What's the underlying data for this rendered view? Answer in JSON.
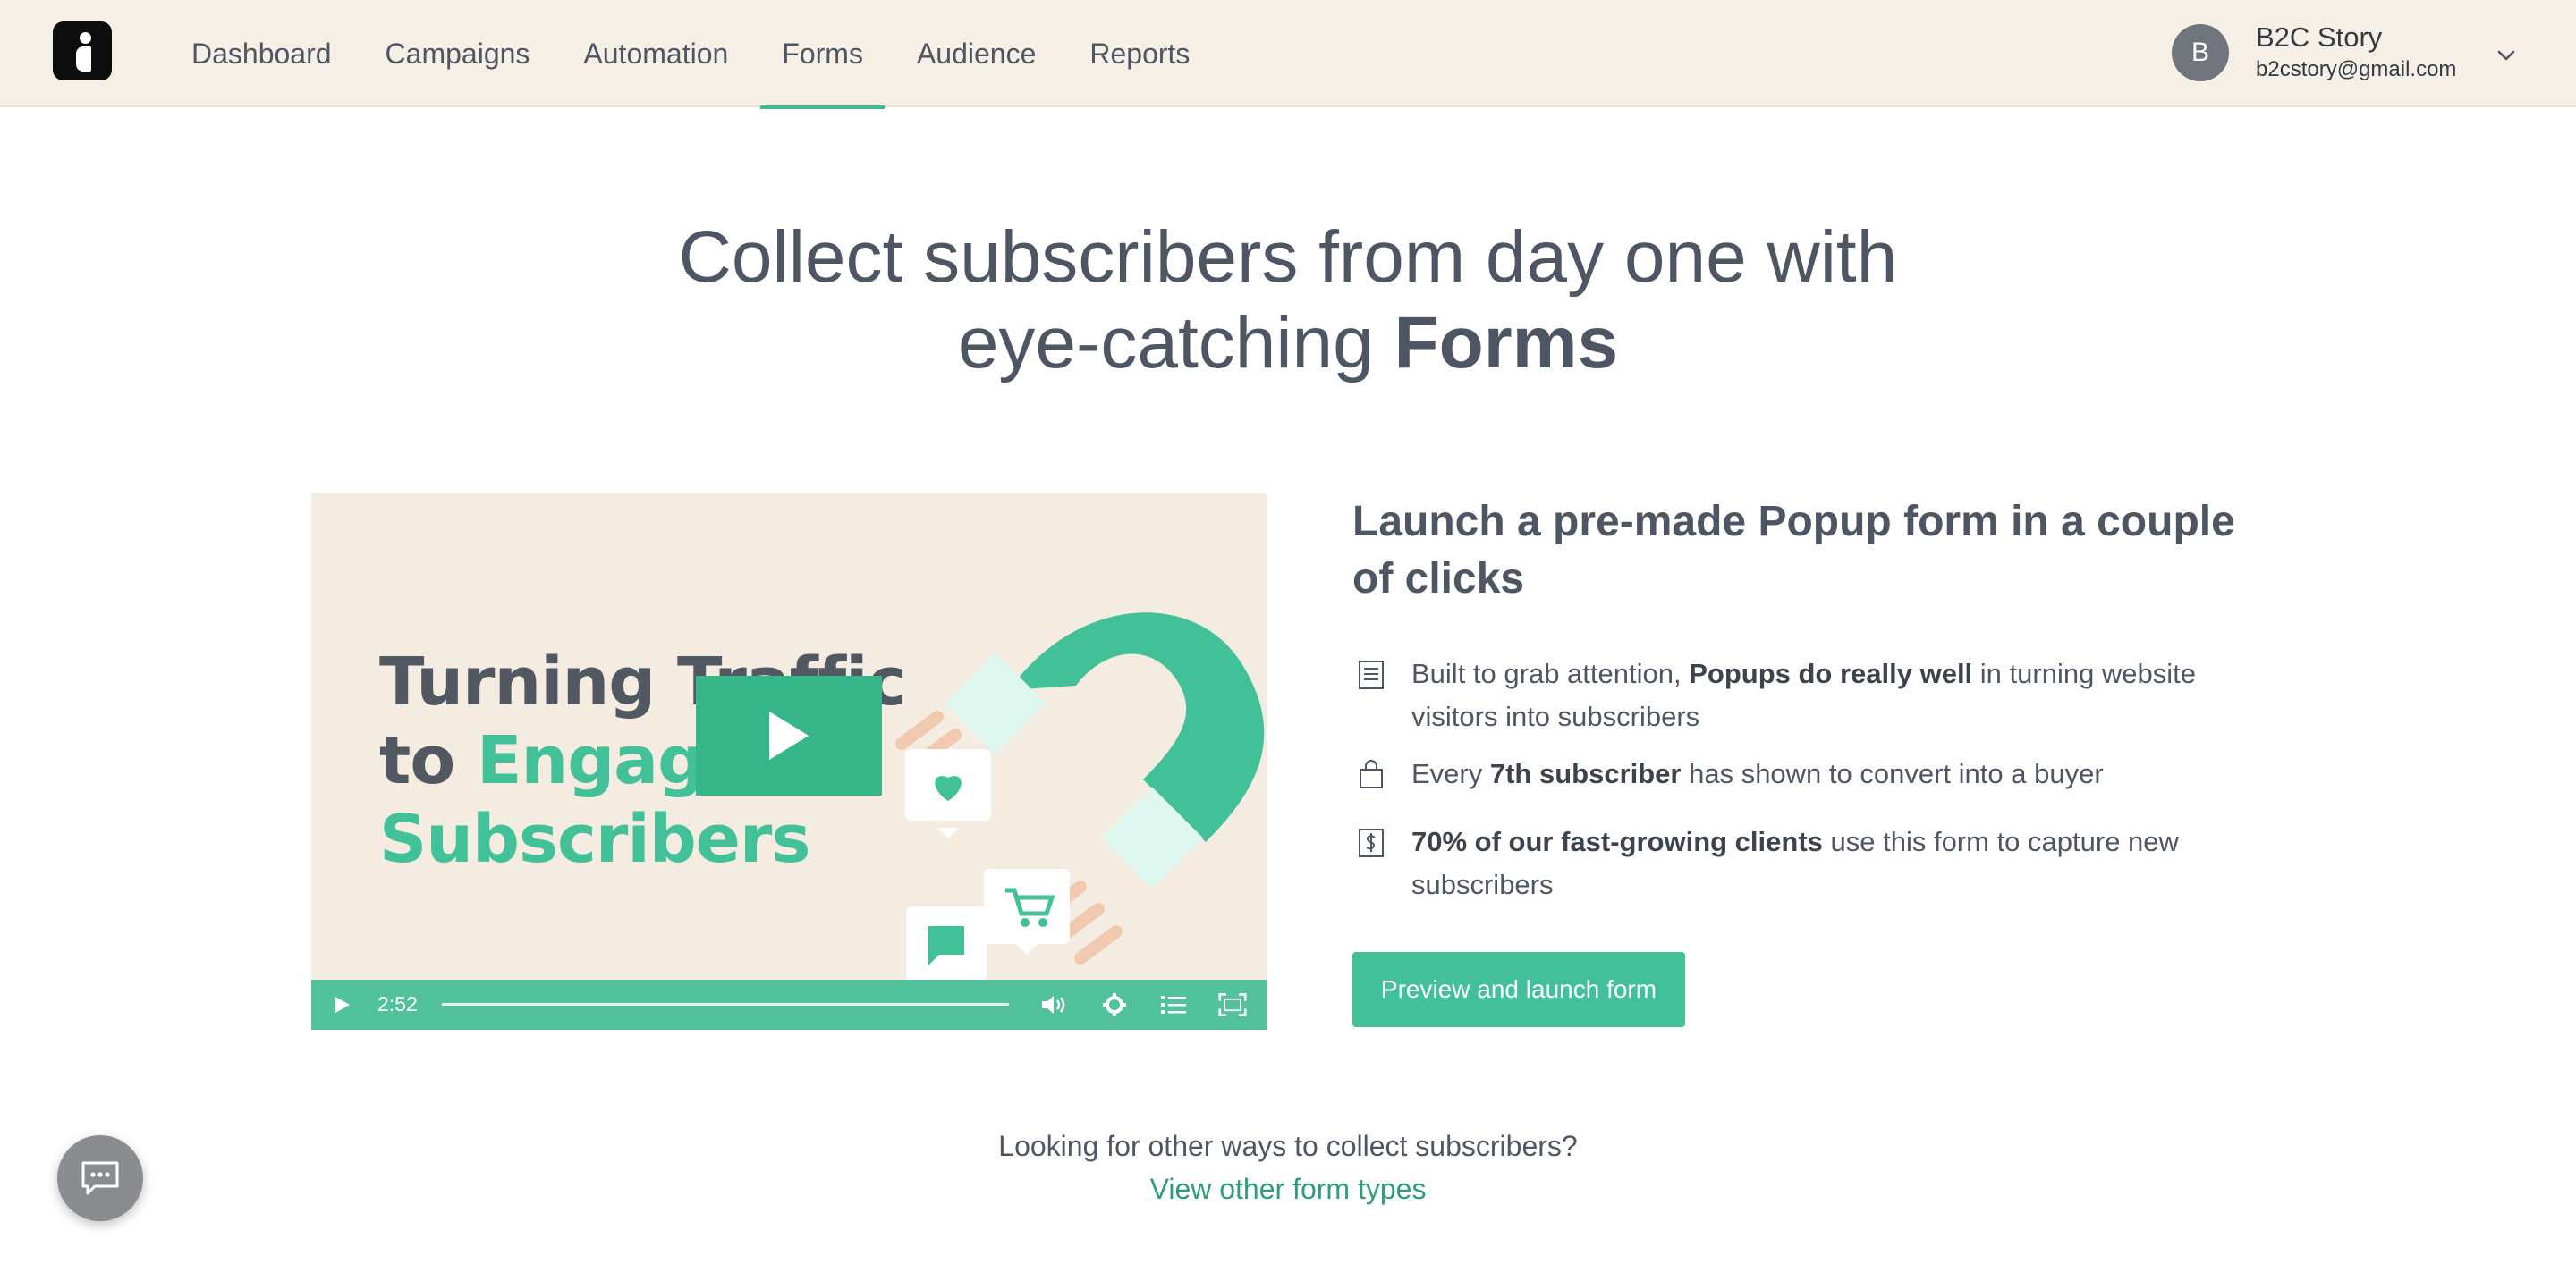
{
  "nav": {
    "items": [
      {
        "label": "Dashboard"
      },
      {
        "label": "Campaigns"
      },
      {
        "label": "Automation"
      },
      {
        "label": "Forms",
        "active": true
      },
      {
        "label": "Audience"
      },
      {
        "label": "Reports"
      }
    ]
  },
  "account": {
    "avatar_initial": "B",
    "name": "B2C Story",
    "email": "b2cstory@gmail.com"
  },
  "hero": {
    "line1": "Collect subscribers from day one with",
    "line2_prefix": "eye-catching ",
    "line2_bold": "Forms"
  },
  "video": {
    "title_line1": "Turning Traffic",
    "title_line2_prefix": "to ",
    "title_line2_accent": "Engaged",
    "title_line3": "Subscribers",
    "duration": "2:52"
  },
  "launch": {
    "title": "Launch a pre-made Popup form in a couple of clicks",
    "features": [
      {
        "icon": "document-icon",
        "pre": "Built to grab attention, ",
        "bold": "Popups do really well",
        "post": " in turning website visitors into subscribers"
      },
      {
        "icon": "shopping-bag-icon",
        "pre": "Every ",
        "bold": "7th subscriber",
        "post": " has shown to convert into a buyer"
      },
      {
        "icon": "money-icon",
        "pre": "",
        "bold": "70% of our fast-growing clients",
        "post": " use this form to capture new subscribers"
      }
    ],
    "cta_label": "Preview and launch form"
  },
  "footer": {
    "question": "Looking for other ways to collect subscribers?",
    "link": "View other form types"
  },
  "colors": {
    "accent": "#42c097",
    "nav_background": "#f6efe5",
    "text": "#4f5663"
  }
}
